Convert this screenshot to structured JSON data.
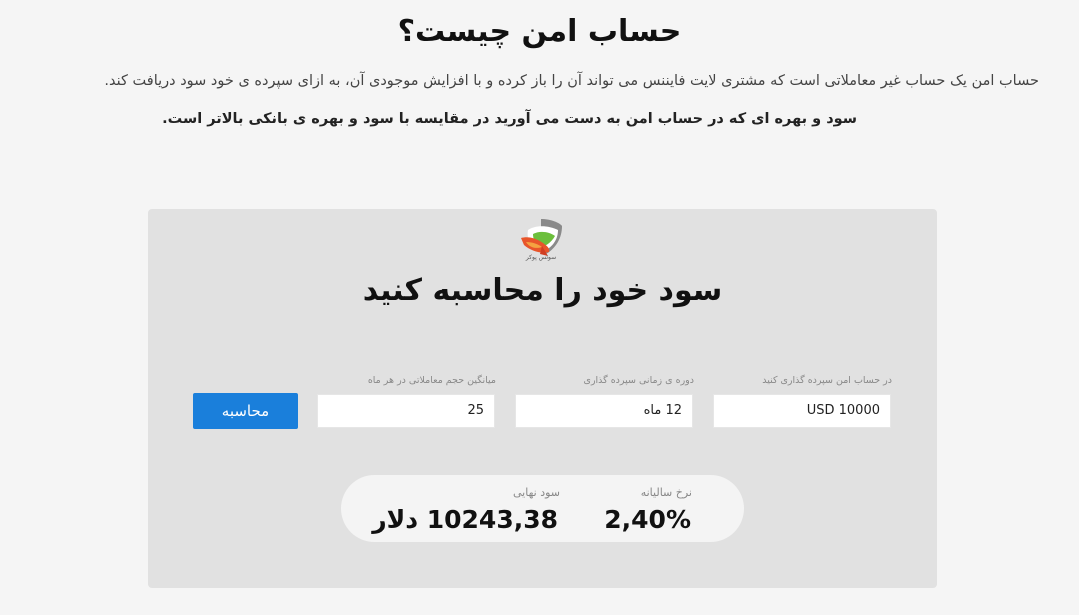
{
  "header": {
    "title": "حساب امن چیست؟",
    "description": "حساب امن یک حساب غیر معاملاتی است که مشتری لایت فایننس می تواند آن را باز کرده و با افزایش موجودی آن، به ازای سپرده ی خود سود دریافت کند.",
    "description_bold": "سود و بهره ای که در حساب امن به دست می آورید در مقایسه با سود و بهره ی بانکی بالاتر است."
  },
  "calculator": {
    "logo_caption": "سوئس پوکر",
    "title": "سود خود را محاسبه کنید",
    "fields": [
      {
        "label": "در حساب امن سپرده گذاری کنید",
        "value": "10000 USD"
      },
      {
        "label": "دوره ی زمانی سپرده گذاری",
        "value": "12 ماه"
      },
      {
        "label": "میانگین حجم معاملاتی در هر ماه",
        "value": "25"
      }
    ],
    "button_label": "محاسبه",
    "results": {
      "annual_rate_label": "نرخ سالیانه",
      "annual_rate_value": "2,40%",
      "final_profit_label": "سود نهایی",
      "final_profit_value": "10243,38 دلار"
    }
  },
  "colors": {
    "accent": "#1a7fdb",
    "card_background": "#e1e1e1",
    "page_background": "#f5f5f5"
  }
}
